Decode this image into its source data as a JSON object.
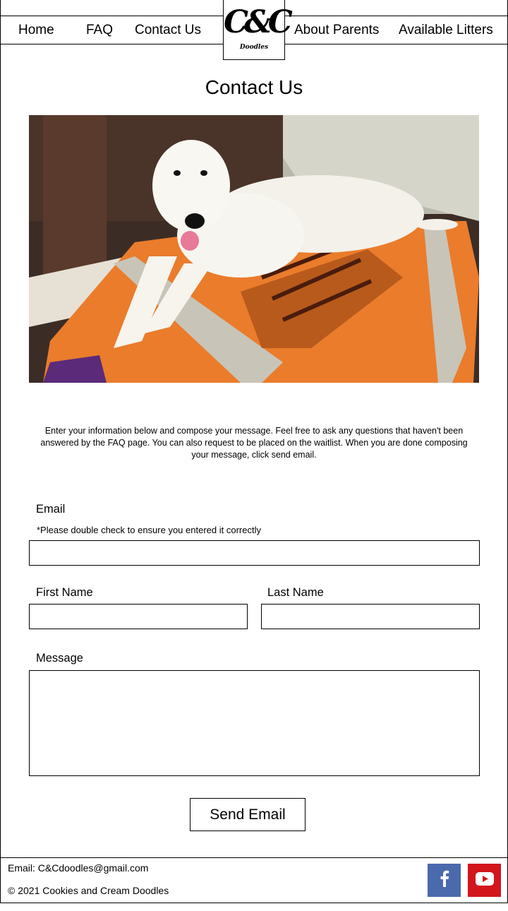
{
  "nav": {
    "items": [
      "Home",
      "FAQ",
      "Contact Us",
      "About Parents",
      "Available Litters"
    ],
    "logo_text": "C&C",
    "logo_sub": "Doodles"
  },
  "page_title": "Contact Us",
  "intro_text": "Enter your information below and compose your message. Feel free to ask any questions that haven't been answered by the FAQ page. You can also request to be placed on the waitlist. When you are done composing your message, click send email.",
  "form": {
    "email_label": "Email",
    "email_hint": "*Please double check to ensure you entered it correctly",
    "email_value": "",
    "first_name_label": "First Name",
    "first_name_value": "",
    "last_name_label": "Last Name",
    "last_name_value": "",
    "message_label": "Message",
    "message_value": "",
    "submit_label": "Send Email"
  },
  "footer": {
    "email": "Email: C&Cdoodles@gmail.com",
    "copyright": "© 2021 Cookies and Cream Doodles"
  },
  "colors": {
    "facebook": "#4b69ad",
    "youtube": "#d2161c"
  },
  "icons": [
    "facebook-icon",
    "youtube-icon"
  ]
}
